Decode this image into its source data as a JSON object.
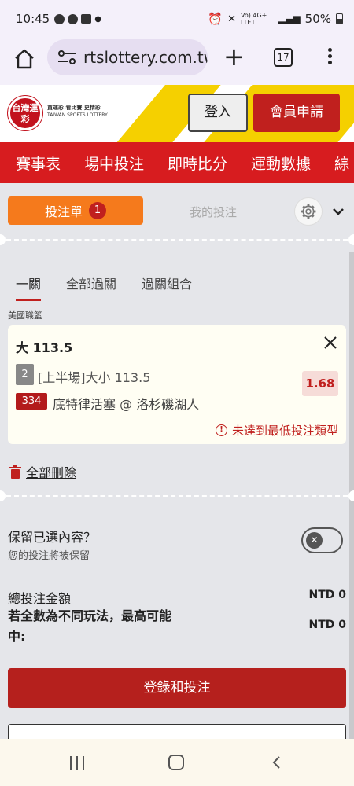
{
  "status_bar": {
    "time": "10:45",
    "network": "Vo) 4G+ LTE1",
    "battery": "50%"
  },
  "browser": {
    "url": "rtslottery.com.tw",
    "tab_count": "17"
  },
  "header": {
    "logo_text": "台灣運彩",
    "logo_tagline": "買運彩 看比賽 更精彩",
    "logo_subtitle": "TAIWAN SPORTS LOTTERY",
    "login_label": "登入",
    "register_label": "會員申請"
  },
  "nav": {
    "items": [
      "賽事表",
      "場中投注",
      "即時比分",
      "運動數據",
      "綜"
    ]
  },
  "betslip": {
    "tab_label": "投注單",
    "badge_count": "1",
    "mybets_label": "我的投注",
    "sub_tabs": [
      "一關",
      "全部過關",
      "過關組合"
    ],
    "league": "美國職籃",
    "bet": {
      "title": "大 113.5",
      "number": "2",
      "description": "[上半場]大小 113.5",
      "odds": "1.68",
      "game_id": "334",
      "game_name": "底特律活塞 @ 洛杉磯湖人",
      "warning": "未達到最低投注類型"
    },
    "delete_all_label": "全部刪除",
    "keep_title": "保留已選內容？",
    "keep_subtitle": "您的投注將被保留",
    "total_label": "總投注金額",
    "total_value": "NTD 0",
    "max_label": "若全數為不同玩法，最高可能中:",
    "max_value": "NTD 0",
    "submit_label": "登錄和投注"
  },
  "colors": {
    "brand_red": "#d71c1f",
    "orange": "#f57a1c",
    "yellow": "#f5d000"
  }
}
